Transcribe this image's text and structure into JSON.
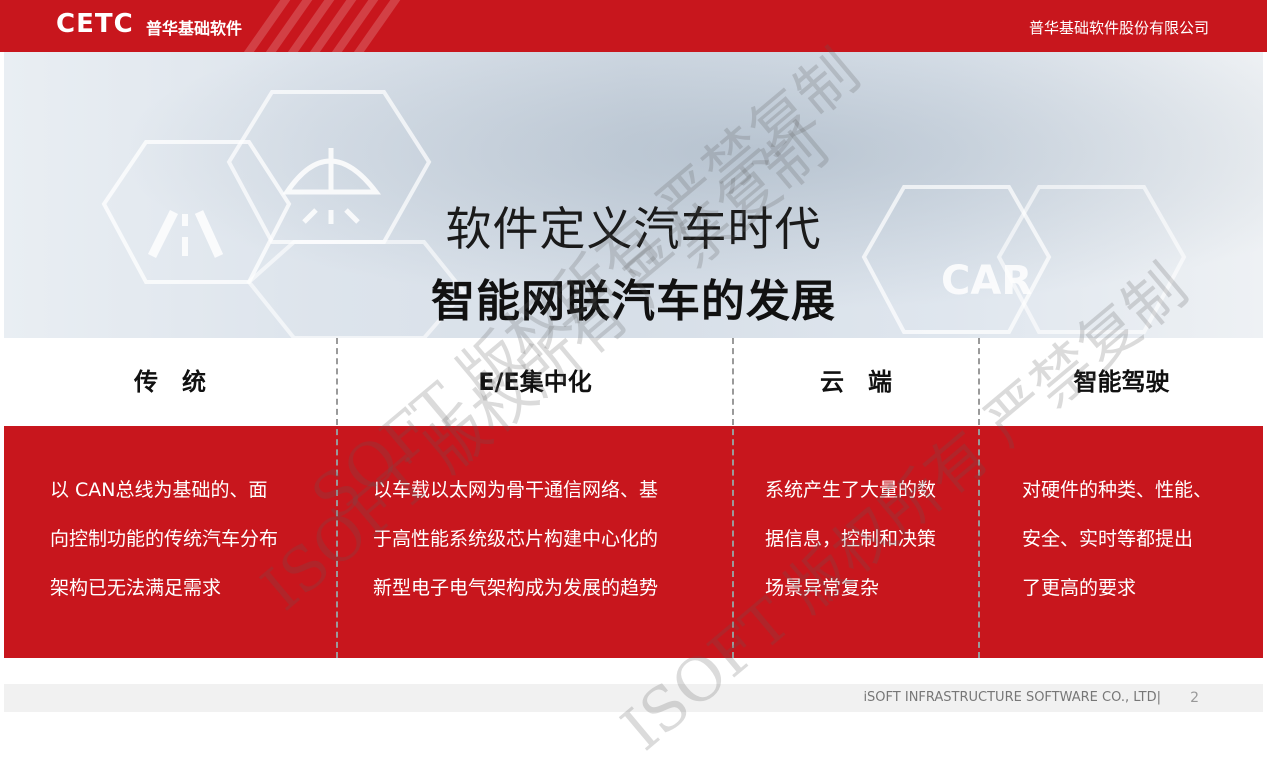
{
  "header": {
    "logo": "CETC",
    "logo_subtitle": "普华基础软件",
    "company": "普华基础软件股份有限公司"
  },
  "hero": {
    "title_line1": "软件定义汽车时代",
    "title_line2": "智能网联汽车的发展",
    "car_badge": "CAR"
  },
  "columns": [
    {
      "heading": "传　统",
      "body": [
        "以 CAN总线为基础的、面",
        "向控制功能的传统汽车分布",
        "架构已无法满足需求"
      ]
    },
    {
      "heading": "E/E集中化",
      "body": [
        "以车载以太网为骨干通信网络、基",
        "于高性能系统级芯片构建中心化的",
        "新型电子电气架构成为发展的趋势"
      ]
    },
    {
      "heading": "云　端",
      "body": [
        "系统产生了大量的数",
        "据信息，控制和决策",
        "场景异常复杂"
      ]
    },
    {
      "heading": "智能驾驶",
      "body": [
        "对硬件的种类、性能、",
        "安全、实时等都提出",
        "了更高的要求"
      ]
    }
  ],
  "footer": {
    "company_en": "iSOFT INFRASTRUCTURE SOFTWARE CO., LTD|",
    "page_number": "2"
  },
  "watermarks": [
    "ISOFT 版权所有 严禁复制",
    "ISOFT 版权所有 严禁复制",
    "SOFT 版权所有 严禁复制"
  ],
  "colors": {
    "brand_red": "#c8161d"
  },
  "icons": [
    "road-icon",
    "windshield-wiper-icon",
    "car-label-icon"
  ]
}
